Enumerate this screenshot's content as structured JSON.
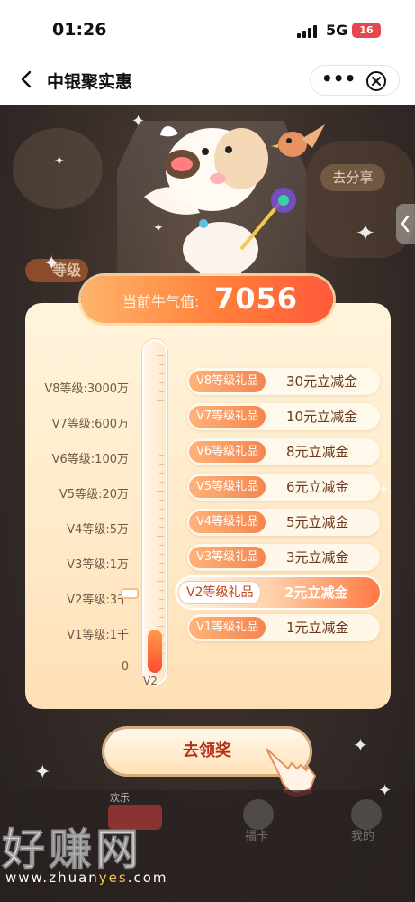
{
  "status": {
    "time": "01:26",
    "network": "5G",
    "battery": "16"
  },
  "nav": {
    "title": "中银聚实惠",
    "more": "•••"
  },
  "background": {
    "level_badge": "等级",
    "share": "去分享"
  },
  "current": {
    "label": "当前牛气值:",
    "value": "7056"
  },
  "levels": [
    {
      "name": "V8等级:3000万"
    },
    {
      "name": "V7等级:600万"
    },
    {
      "name": "V6等级:100万"
    },
    {
      "name": "V5等级:20万"
    },
    {
      "name": "V4等级:5万"
    },
    {
      "name": "V3等级:1万"
    },
    {
      "name": "V2等级:3千"
    },
    {
      "name": "V1等级:1千"
    },
    {
      "name": "0"
    }
  ],
  "thermometer": {
    "current_level_tag": "V2",
    "fill_fraction": 0.1
  },
  "rewards": [
    {
      "tag": "V8等级礼品",
      "amount": "30元立减金",
      "active": false
    },
    {
      "tag": "V7等级礼品",
      "amount": "10元立减金",
      "active": false
    },
    {
      "tag": "V6等级礼品",
      "amount": "8元立减金",
      "active": false
    },
    {
      "tag": "V5等级礼品",
      "amount": "6元立减金",
      "active": false
    },
    {
      "tag": "V4等级礼品",
      "amount": "5元立减金",
      "active": false
    },
    {
      "tag": "V3等级礼品",
      "amount": "3元立减金",
      "active": false
    },
    {
      "tag": "V2等级礼品",
      "amount": "2元立减金",
      "active": true
    },
    {
      "tag": "V1等级礼品",
      "amount": "1元立减金",
      "active": false
    }
  ],
  "claim_button": "去领奖",
  "bottom": {
    "chip_label": "欢乐",
    "items": [
      "福卡",
      "我的"
    ]
  },
  "watermark": {
    "text": "好赚网",
    "url_prefix": "www.zhuan",
    "url_highlight": "yes",
    "url_suffix": ".com"
  }
}
